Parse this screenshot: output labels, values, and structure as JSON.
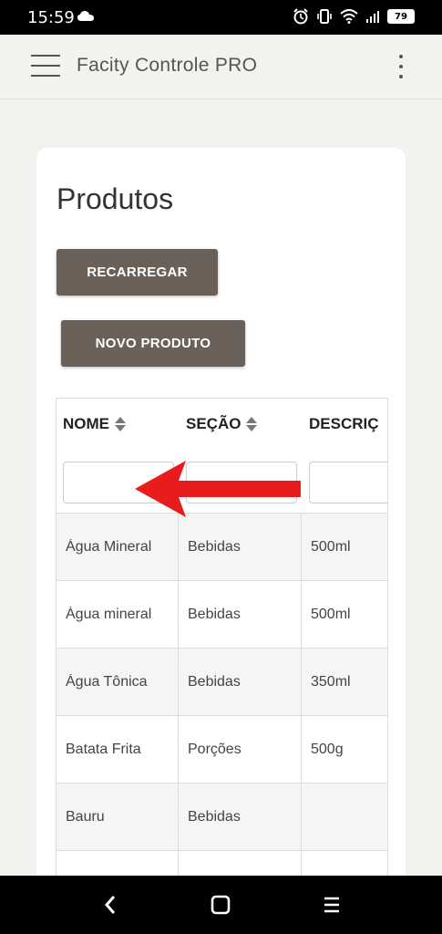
{
  "status_bar": {
    "time": "15:59",
    "battery": "79",
    "icons": [
      "cloud-icon",
      "alarm-icon",
      "vibrate-icon",
      "wifi-icon",
      "signal-icon",
      "battery-icon"
    ]
  },
  "app_bar": {
    "title": "Facity Controle PRO",
    "icons": [
      "hamburger-menu-icon",
      "more-vert-icon"
    ]
  },
  "page": {
    "title": "Produtos",
    "reload_label": "RECARREGAR",
    "new_label": "NOVO PRODUTO"
  },
  "table": {
    "columns": [
      {
        "label": "NOME",
        "sortable": true
      },
      {
        "label": "SEÇÃO",
        "sortable": true
      },
      {
        "label": "DESCRIÇ",
        "sortable": false
      }
    ],
    "filters": {
      "nome": "",
      "secao": "",
      "descricao": ""
    },
    "rows": [
      {
        "nome": "Água Mineral",
        "secao": "Bebidas",
        "descricao": "500ml"
      },
      {
        "nome": "Àgua mineral",
        "secao": "Bebidas",
        "descricao": "500ml"
      },
      {
        "nome": "Água Tônica",
        "secao": "Bebidas",
        "descricao": "350ml"
      },
      {
        "nome": "Batata Frita",
        "secao": "Porções",
        "descricao": "500g"
      },
      {
        "nome": "Bauru",
        "secao": "Bebidas",
        "descricao": ""
      },
      {
        "nome": "",
        "secao": "",
        "descricao": ""
      }
    ]
  },
  "annotation": {
    "color": "#e81c1c",
    "icon": "red-arrow-left-icon"
  },
  "colors": {
    "button": "#6b6058",
    "background": "#f3f2ef",
    "card": "#ffffff"
  }
}
